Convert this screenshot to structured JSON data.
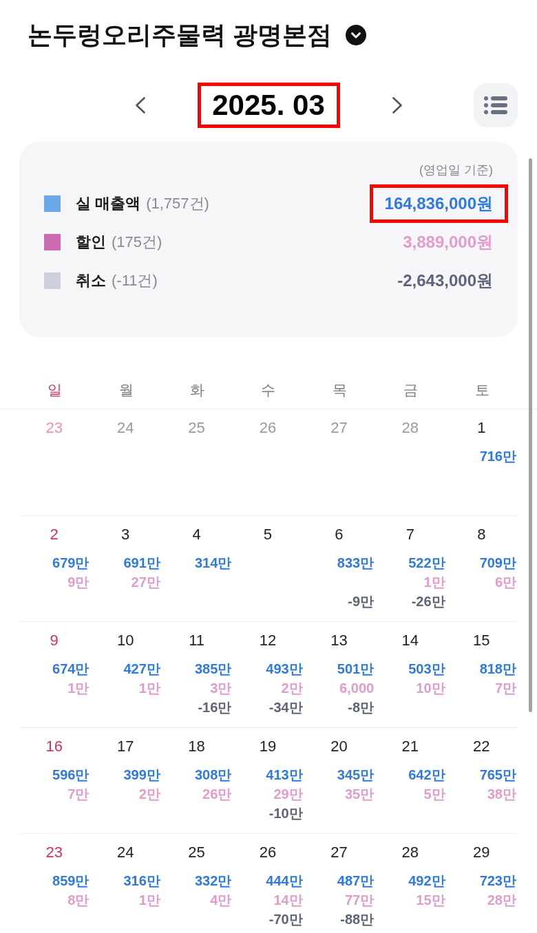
{
  "header": {
    "store_name": "논두렁오리주물력 광명본점"
  },
  "month_nav": {
    "month": "2025. 03",
    "highlighted": true
  },
  "summary": {
    "note": "(영업일 기준)",
    "rows": [
      {
        "kind": "sales",
        "label": "실 매출액",
        "count": "(1,757건)",
        "amount": "164,836,000원",
        "color": "#6aa8e6",
        "highlighted": true
      },
      {
        "kind": "discount",
        "label": "할인",
        "count": "(175건)",
        "amount": "3,889,000원",
        "color": "#cc6ab4",
        "highlighted": false
      },
      {
        "kind": "cancel",
        "label": "취소",
        "count": "(-11건)",
        "amount": "-2,643,000원",
        "color": "#cdd0dc",
        "highlighted": false
      }
    ]
  },
  "calendar": {
    "weekdays": [
      "일",
      "월",
      "화",
      "수",
      "목",
      "금",
      "토"
    ],
    "weeks": [
      {
        "days": [
          {
            "date": "23",
            "outside": true
          },
          {
            "date": "24",
            "outside": true
          },
          {
            "date": "25",
            "outside": true
          },
          {
            "date": "26",
            "outside": true
          },
          {
            "date": "27",
            "outside": true
          },
          {
            "date": "28",
            "outside": true
          },
          {
            "date": "1",
            "outside": false,
            "sales": "716만"
          }
        ]
      },
      {
        "days": [
          {
            "date": "2",
            "outside": false,
            "sales": "679만",
            "discount": "9만"
          },
          {
            "date": "3",
            "outside": false,
            "sales": "691만",
            "discount": "27만"
          },
          {
            "date": "4",
            "outside": false,
            "sales": "314만"
          },
          {
            "date": "5",
            "outside": false
          },
          {
            "date": "6",
            "outside": false,
            "sales": "833만",
            "cancel": "-9만"
          },
          {
            "date": "7",
            "outside": false,
            "sales": "522만",
            "discount": "1만",
            "cancel": "-26만"
          },
          {
            "date": "8",
            "outside": false,
            "sales": "709만",
            "discount": "6만"
          }
        ]
      },
      {
        "days": [
          {
            "date": "9",
            "outside": false,
            "sales": "674만",
            "discount": "1만"
          },
          {
            "date": "10",
            "outside": false,
            "sales": "427만",
            "discount": "1만"
          },
          {
            "date": "11",
            "outside": false,
            "sales": "385만",
            "discount": "3만",
            "cancel": "-16만"
          },
          {
            "date": "12",
            "outside": false,
            "sales": "493만",
            "discount": "2만",
            "cancel": "-34만"
          },
          {
            "date": "13",
            "outside": false,
            "sales": "501만",
            "discount": "6,000",
            "cancel": "-8만"
          },
          {
            "date": "14",
            "outside": false,
            "sales": "503만",
            "discount": "10만"
          },
          {
            "date": "15",
            "outside": false,
            "sales": "818만",
            "discount": "7만"
          }
        ]
      },
      {
        "days": [
          {
            "date": "16",
            "outside": false,
            "sales": "596만",
            "discount": "7만"
          },
          {
            "date": "17",
            "outside": false,
            "sales": "399만",
            "discount": "2만"
          },
          {
            "date": "18",
            "outside": false,
            "sales": "308만",
            "discount": "26만"
          },
          {
            "date": "19",
            "outside": false,
            "sales": "413만",
            "discount": "29만",
            "cancel": "-10만"
          },
          {
            "date": "20",
            "outside": false,
            "sales": "345만",
            "discount": "35만"
          },
          {
            "date": "21",
            "outside": false,
            "sales": "642만",
            "discount": "5만"
          },
          {
            "date": "22",
            "outside": false,
            "sales": "765만",
            "discount": "38만"
          }
        ]
      },
      {
        "days": [
          {
            "date": "23",
            "outside": false,
            "sales": "859만",
            "discount": "8만"
          },
          {
            "date": "24",
            "outside": false,
            "sales": "316만",
            "discount": "1만"
          },
          {
            "date": "25",
            "outside": false,
            "sales": "332만",
            "discount": "4만"
          },
          {
            "date": "26",
            "outside": false,
            "sales": "444만",
            "discount": "14만",
            "cancel": "-70만"
          },
          {
            "date": "27",
            "outside": false,
            "sales": "487만",
            "discount": "77만",
            "cancel": "-88만"
          },
          {
            "date": "28",
            "outside": false,
            "sales": "492만",
            "discount": "15만"
          },
          {
            "date": "29",
            "outside": false,
            "sales": "723만",
            "discount": "28만"
          }
        ]
      }
    ]
  }
}
